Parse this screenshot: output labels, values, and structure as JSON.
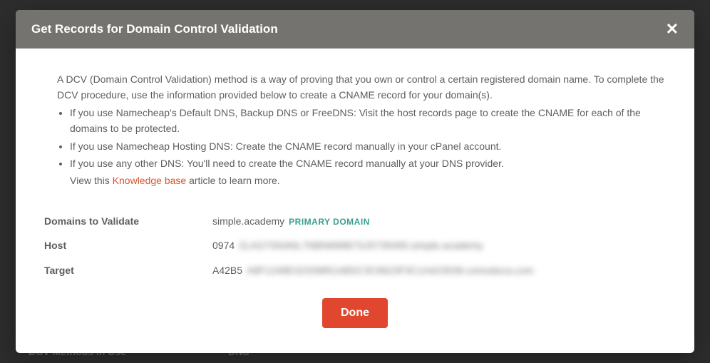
{
  "background": {
    "label_left": "DCV Methods in Use",
    "label_right": "DNS"
  },
  "modal": {
    "title": "Get Records for Domain Control Validation",
    "intro": "A DCV (Domain Control Validation) method is a way of proving that you own or control a certain registered domain name. To complete the DCV procedure, use the information provided below to create a CNAME record for your domain(s).",
    "bullets": [
      "If you use Namecheap's Default DNS, Backup DNS or FreeDNS: Visit the host records page to create the CNAME for each of the domains to be protected.",
      "If you use Namecheap Hosting DNS: Create the CNAME record manually in your cPanel account.",
      "If you use any other DNS: You'll need to create the CNAME record manually at your DNS provider."
    ],
    "view_prefix": "View this ",
    "kb_link": "Knowledge base",
    "view_suffix": " article to learn more.",
    "records": {
      "domains_label": "Domains to Validate",
      "domains_value": "simple.academy",
      "primary_badge": "PRIMARY DOMAIN",
      "host_label": "Host",
      "host_prefix": "0974",
      "host_blurred": "2LAG7SN4NL7NBN698B7SJ5735495.simple.academy",
      "target_label": "Target",
      "target_prefix": "A42B5",
      "target_blurred": "A8F1248E3233985148DC3C9623F3C1A423538.comodoca.com"
    },
    "done_button": "Done"
  }
}
